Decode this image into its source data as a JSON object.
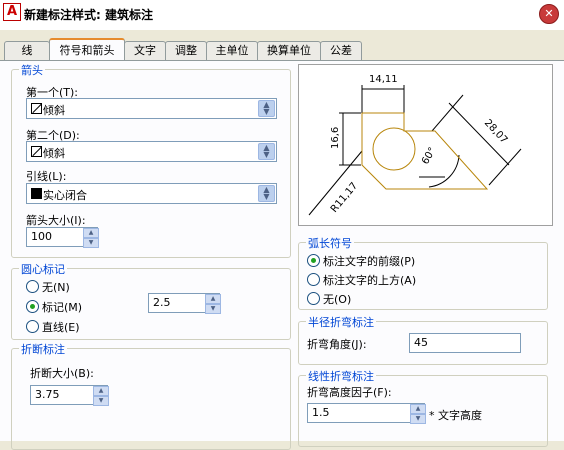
{
  "window": {
    "title": "新建标注样式: 建筑标注",
    "app_icon": "A"
  },
  "tabs": [
    {
      "label": "线"
    },
    {
      "label": "符号和箭头"
    },
    {
      "label": "文字"
    },
    {
      "label": "调整"
    },
    {
      "label": "主单位"
    },
    {
      "label": "换算单位"
    },
    {
      "label": "公差"
    }
  ],
  "arrows": {
    "legend": "箭头",
    "first_label": "第一个(T):",
    "first_value": "倾斜",
    "second_label": "第二个(D):",
    "second_value": "倾斜",
    "leader_label": "引线(L):",
    "leader_value": "实心闭合",
    "size_label": "箭头大小(I):",
    "size_value": "100"
  },
  "center_marks": {
    "legend": "圆心标记",
    "none": "无(N)",
    "mark": "标记(M)",
    "line": "直线(E)",
    "value": "2.5"
  },
  "break": {
    "legend": "折断标注",
    "size_label": "折断大小(B):",
    "size_value": "3.75"
  },
  "preview": {
    "dim_top": "14,11",
    "dim_left": "16,6",
    "dim_right": "28,07",
    "dim_radius": "R11,17",
    "dim_angle": "60°"
  },
  "arc_length": {
    "legend": "弧长符号",
    "before": "标注文字的前缀(P)",
    "above": "标注文字的上方(A)",
    "none": "无(O)"
  },
  "radius_jog": {
    "legend": "半径折弯标注",
    "angle_label": "折弯角度(J):",
    "angle_value": "45"
  },
  "linear_jog": {
    "legend": "线性折弯标注",
    "height_label": "折弯高度因子(F):",
    "height_value": "1.5",
    "suffix": "* 文字高度"
  }
}
